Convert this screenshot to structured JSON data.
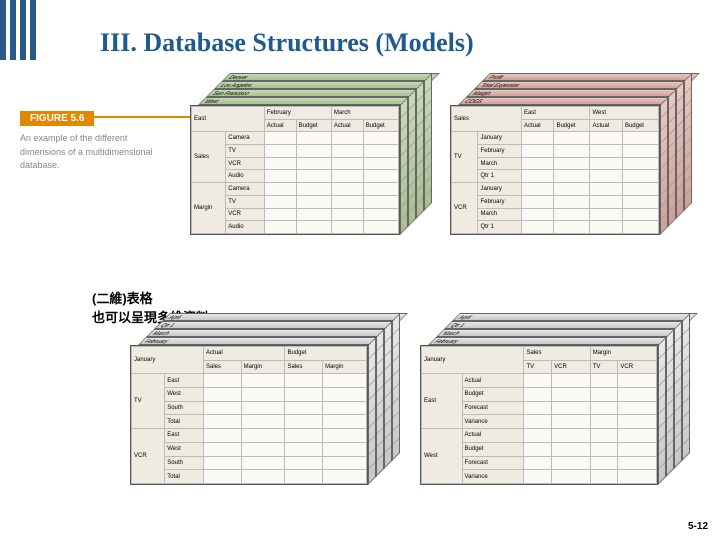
{
  "title": "III. Database Structures (Models)",
  "figure": {
    "number": "FIGURE 5.6",
    "description": "An example of the different dimensions of a multidimensional database."
  },
  "note_line1": "(二維)表格",
  "note_line2": "也可以呈現多維資料",
  "page_num": "5-12",
  "chart_data": [
    {
      "id": "cube1",
      "type": "cube-table",
      "top_layers": [
        "Denver",
        "Los Angeles",
        "San Francisco",
        "West"
      ],
      "front": {
        "row_group_header": "East",
        "col_groups": [
          {
            "name": "February",
            "cols": [
              "Actual",
              "Budget"
            ]
          },
          {
            "name": "March",
            "cols": [
              "Actual",
              "Budget"
            ]
          }
        ],
        "row_groups": [
          {
            "name": "Sales",
            "rows": [
              "Camera",
              "TV",
              "VCR",
              "Audio"
            ]
          },
          {
            "name": "Margin",
            "rows": [
              "Camera",
              "TV",
              "VCR",
              "Audio"
            ]
          }
        ]
      },
      "shade": "green"
    },
    {
      "id": "cube2",
      "type": "cube-table",
      "top_layers": [
        "Profit",
        "Total Expenses",
        "Margin",
        "COGS"
      ],
      "front": {
        "row_group_header": "Sales",
        "col_groups": [
          {
            "name": "East",
            "cols": [
              "Actual",
              "Budget"
            ]
          },
          {
            "name": "West",
            "cols": [
              "Actual",
              "Budget"
            ]
          }
        ],
        "row_groups": [
          {
            "name": "TV",
            "rows": [
              "January",
              "February",
              "March",
              "Qtr 1"
            ]
          },
          {
            "name": "VCR",
            "rows": [
              "January",
              "February",
              "March",
              "Qtr 1"
            ]
          }
        ]
      },
      "shade": "red"
    },
    {
      "id": "cube3",
      "type": "cube-table",
      "top_layers": [
        "April",
        "Qtr 1",
        "March",
        "February"
      ],
      "front": {
        "row_group_header": "January",
        "col_groups": [
          {
            "name": "Actual",
            "cols": [
              "Sales",
              "Margin"
            ]
          },
          {
            "name": "Budget",
            "cols": [
              "Sales",
              "Margin"
            ]
          }
        ],
        "row_groups": [
          {
            "name": "TV",
            "rows": [
              "East",
              "West",
              "South",
              "Total"
            ]
          },
          {
            "name": "VCR",
            "rows": [
              "East",
              "West",
              "South",
              "Total"
            ]
          }
        ]
      },
      "shade": "gray"
    },
    {
      "id": "cube4",
      "type": "cube-table",
      "top_layers": [
        "April",
        "Qtr 1",
        "March",
        "February"
      ],
      "front": {
        "row_group_header": "January",
        "col_groups": [
          {
            "name": "Sales",
            "cols": [
              "TV",
              "VCR"
            ]
          },
          {
            "name": "Margin",
            "cols": [
              "TV",
              "VCR"
            ]
          }
        ],
        "row_groups": [
          {
            "name": "East",
            "rows": [
              "Actual",
              "Budget",
              "Forecast",
              "Variance"
            ]
          },
          {
            "name": "West",
            "rows": [
              "Actual",
              "Budget",
              "Forecast",
              "Variance"
            ]
          }
        ]
      },
      "shade": "gray"
    }
  ]
}
